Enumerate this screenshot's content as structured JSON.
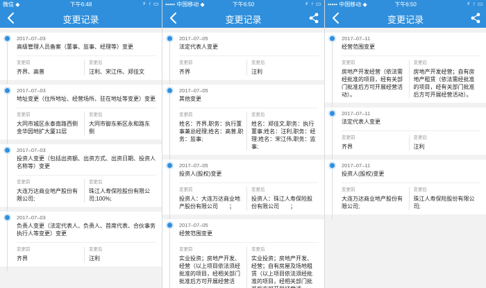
{
  "colors": {
    "accent": "#2f8fdc"
  },
  "panels": [
    {
      "status": {
        "carrier": "微信 ◆",
        "time": "下午6:48",
        "icons": "⚡ ↑ ▭"
      },
      "nav_title": "变更记录",
      "show_share": false,
      "labels": {
        "before": "变更前",
        "after": "变更后"
      },
      "records": [
        {
          "date": "2017–07–03",
          "title": "高级管理人员备案（董事、监事、经理等）变更",
          "before": "齐界、高普",
          "after": "汪利、宋江伟、郑佳文"
        },
        {
          "date": "2017–07–03",
          "title": "地址变更（住所地址、经营场所、驻在地址等变更）变更",
          "before": "大同市城区永泰南路西侧金华园地扩大厦11层",
          "after": "大同市御东新区永和路东侧"
        },
        {
          "date": "2017–07–03",
          "title": "投资人变更（包括出资额、出资方式、出资日期、投资人名称等）变更",
          "before": "大连万达商业地产股份有限公司;",
          "after": "珠江人寿保险股份有限公司;100%;"
        },
        {
          "date": "2017–07–03",
          "title": "负责人变更（法定代表人、负责人、首席代表、合伙事务执行人等变更）变更",
          "before": "齐界",
          "after": "汪利"
        }
      ]
    },
    {
      "status": {
        "carrier": "••••• 中国移动 ◆",
        "time": "下午6:50",
        "icons": "⚡ ↑ ▭"
      },
      "nav_title": "变更记录",
      "show_share": true,
      "labels": {
        "before": "变更前",
        "after": "变更后"
      },
      "records": [
        {
          "date": "2017–07–05",
          "title": "法定代表人变更",
          "before": "齐界",
          "after": "汪利"
        },
        {
          "date": "2017–07–05",
          "title": "其他变更",
          "before": "姓名：齐界,职务：执行董事兼总经理;姓名：高普,职务：监事;",
          "after": "姓名：郑佳文,职务：执行董事;姓名：汪利,职务：经理;姓名：宋江伟,职务：监事;"
        },
        {
          "date": "2017–07–05",
          "title": "投资人(股权)变更",
          "before": "投资人：大连万达商业地产股份有限公司　　；",
          "after": "投资人：珠江人寿保险股份有限公司　　；"
        },
        {
          "date": "2017–07–05",
          "title": "经营范围变更",
          "before": "实业投资；房地产开发、经营（以上项目依法须经批准的项目，经相关部门批准后方可开展经营活",
          "after": "实业投资；房地产开发、经营；自有房屋及场地租赁（以上项目依法须经批准的项目，经相关部门批准后方可开展经营活"
        }
      ]
    },
    {
      "status": {
        "carrier": "••••• 中国移动 ◆",
        "time": "下午6:50",
        "icons": "⚡ ↑ ▭"
      },
      "nav_title": "变更记录",
      "show_share": true,
      "labels": {
        "before": "变更前",
        "after": "变更后"
      },
      "records": [
        {
          "date": "2017–07–11",
          "title": "经营范围变更",
          "before": "房地产开发经营（依法需经批准的项目，经有关部门批准后方可开展经营活动）。",
          "after": "房地产开发经营；自有房地产租赁（依法需经批准的项目，经有关部门批准后方可开展经营活动）。"
        },
        {
          "date": "2017–07–11",
          "title": "法定代表人变更",
          "before": "齐界",
          "after": "汪利"
        },
        {
          "date": "2017–07–11",
          "title": "投资人(股权)变更",
          "before": "大连万达商业地产股份有限公司;",
          "after": "珠江人寿保险股份有限公司;"
        }
      ]
    }
  ]
}
